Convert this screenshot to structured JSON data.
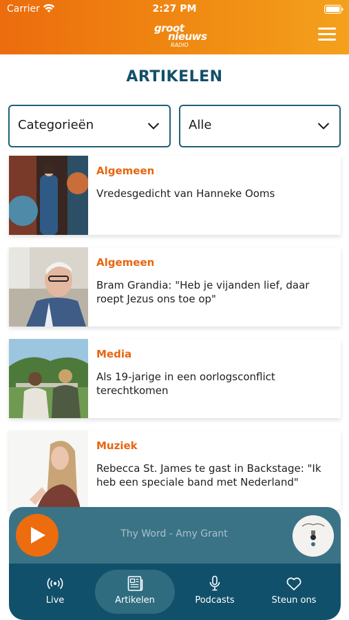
{
  "status_bar": {
    "carrier": "Carrier",
    "time": "2:27 PM"
  },
  "header": {
    "logo_line1": "groot",
    "logo_line2": "nieuws",
    "logo_line3": "RADIO",
    "brand_color": "#ec6c0e"
  },
  "page": {
    "title": "ARTIKELEN"
  },
  "filters": {
    "category": "Categorieën",
    "scope": "Alle"
  },
  "articles": [
    {
      "category": "Algemeen",
      "title": "Vredesgedicht van Hanneke Ooms"
    },
    {
      "category": "Algemeen",
      "title": "Bram Grandia: \"Heb je vijanden lief, daar roept Jezus ons toe op\""
    },
    {
      "category": "Media",
      "title": "Als 19-jarige in een oorlogsconflict terechtkomen"
    },
    {
      "category": "Muziek",
      "title": "Rebecca St. James te gast in Backstage: \"Ik heb een speciale band met Nederland\""
    }
  ],
  "player": {
    "now_playing": "Thy Word - Amy Grant",
    "play_icon": "play-icon"
  },
  "tabs": [
    {
      "label": "Live",
      "icon": "broadcast-icon",
      "active": false
    },
    {
      "label": "Artikelen",
      "icon": "newspaper-icon",
      "active": true
    },
    {
      "label": "Podcasts",
      "icon": "microphone-icon",
      "active": false
    },
    {
      "label": "Steun ons",
      "icon": "heart-icon",
      "active": false
    }
  ],
  "colors": {
    "accent": "#e8650f",
    "primary": "#11506a",
    "player_bg": "#3b7386"
  }
}
